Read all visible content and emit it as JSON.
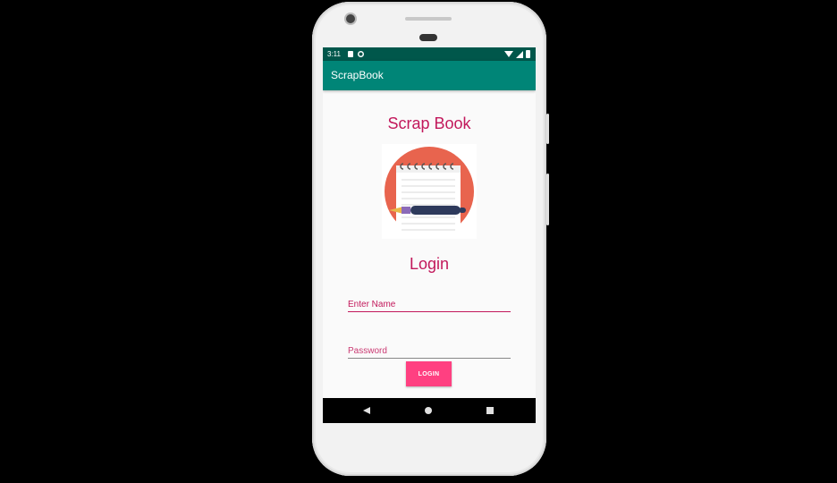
{
  "status_bar": {
    "time": "3:11",
    "icons": [
      "sd-card-icon",
      "sync-icon",
      "wifi-icon",
      "cell-signal-icon",
      "battery-icon"
    ]
  },
  "app_bar": {
    "title": "ScrapBook",
    "color": "#008577"
  },
  "main": {
    "app_heading": "Scrap Book",
    "logo_icon": "notepad-with-pen-icon",
    "login_heading": "Login",
    "name_field": {
      "placeholder": "Enter Name",
      "value": ""
    },
    "password_field": {
      "placeholder": "Password",
      "value": ""
    },
    "login_button": "LOGIN"
  },
  "nav_bar": {
    "icons": [
      "back-icon",
      "home-icon",
      "recents-icon"
    ]
  },
  "colors": {
    "accent": "#ff4081",
    "primary": "#008577",
    "primary_dark": "#00574b",
    "text_heading": "#c2185b"
  }
}
